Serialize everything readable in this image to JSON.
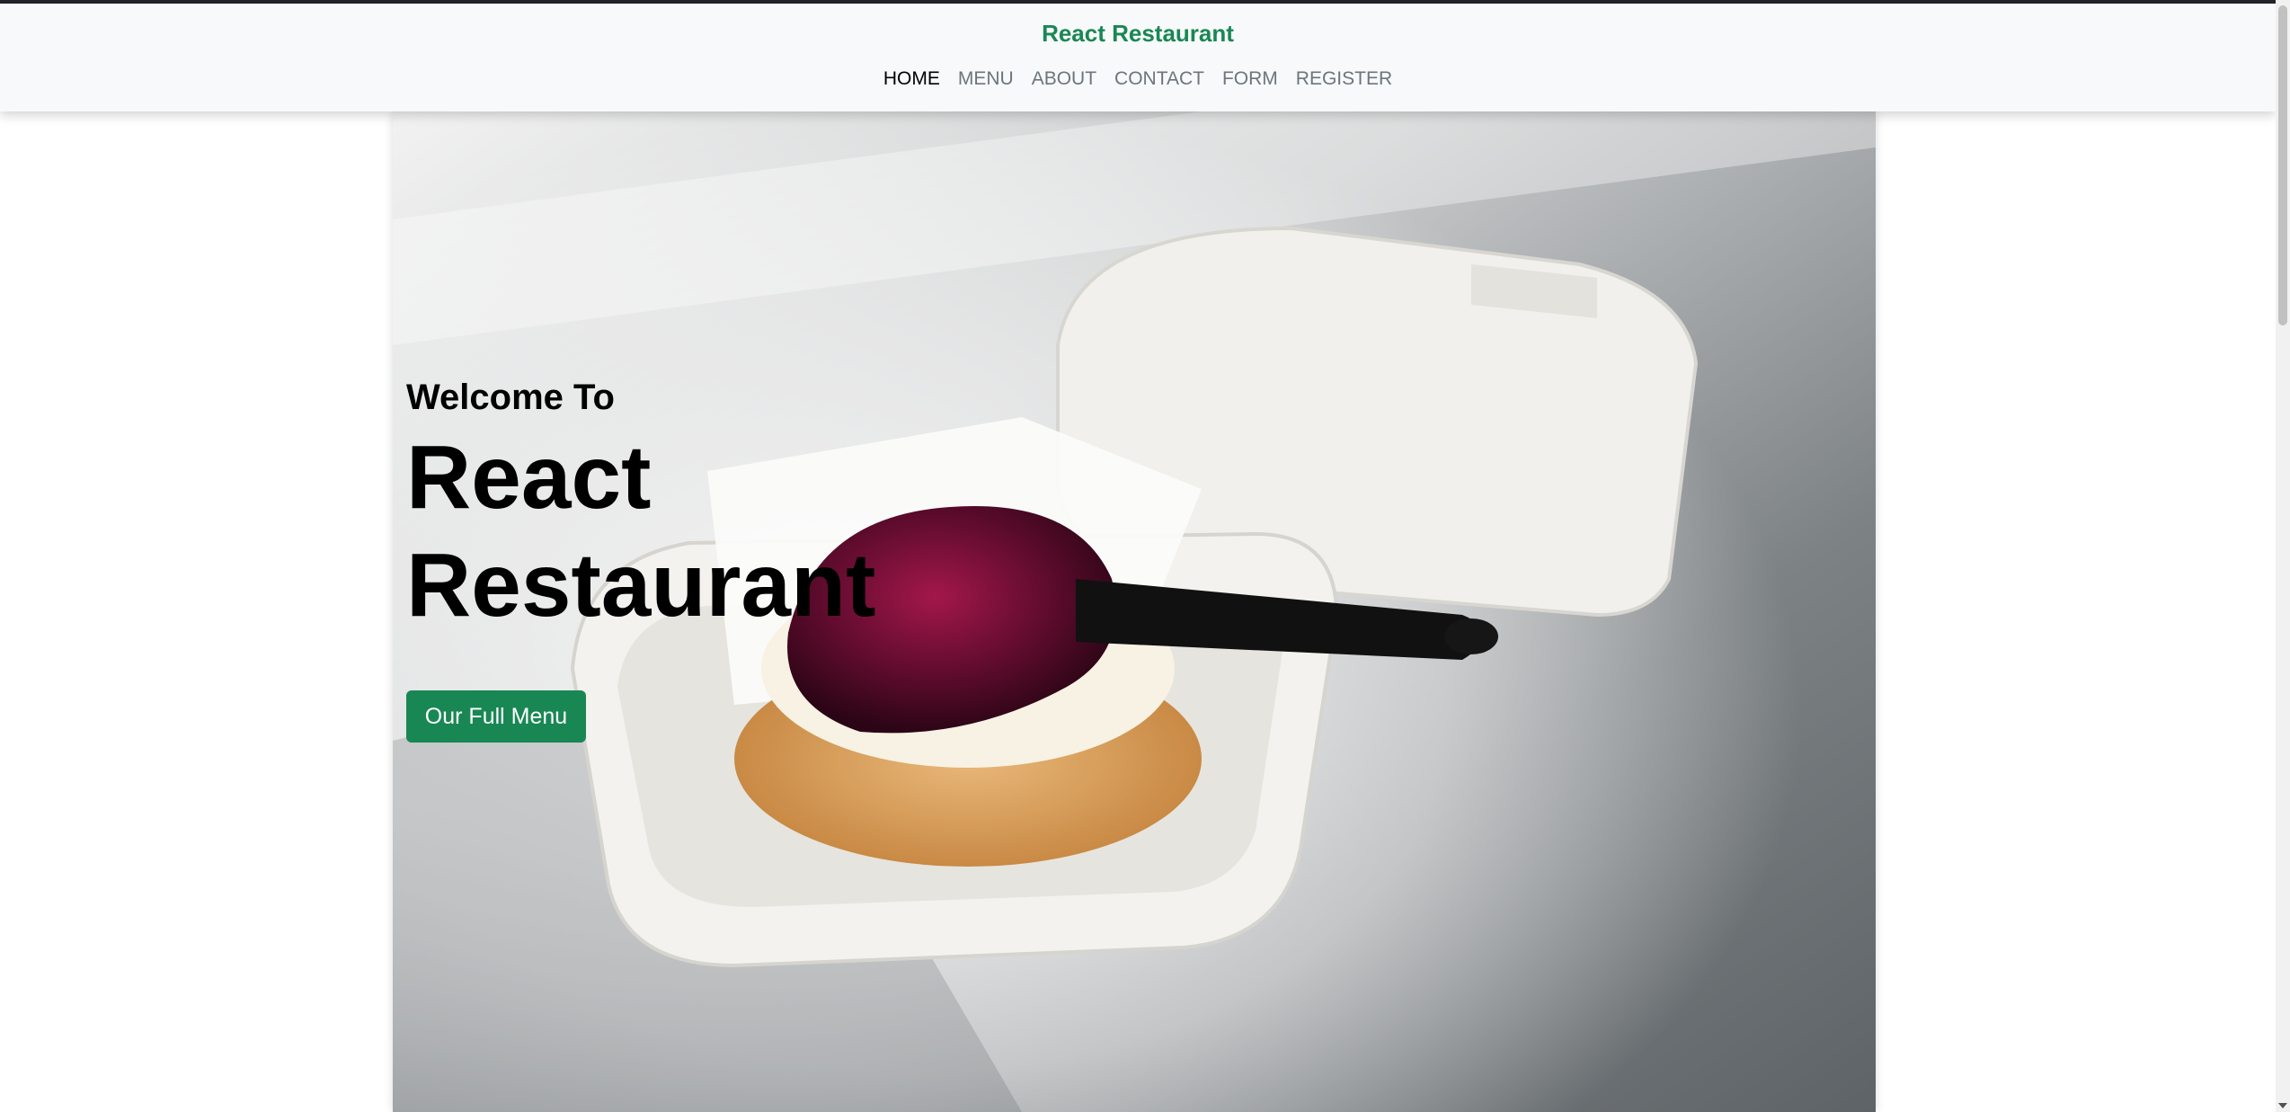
{
  "navbar": {
    "brand": "React Restaurant",
    "links": [
      "HOME",
      "MENU",
      "ABOUT",
      "CONTACT",
      "FORM",
      "REGISTER"
    ],
    "active_link": "HOME"
  },
  "hero": {
    "welcome": "Welcome To",
    "title_line1": "React",
    "title_line2": "Restaurant",
    "button_label": "Our Full Menu"
  },
  "colors": {
    "brand": "#198754",
    "nav_bg": "#f8f9fa",
    "nav_text": "#6c757d",
    "nav_active": "#000000"
  }
}
